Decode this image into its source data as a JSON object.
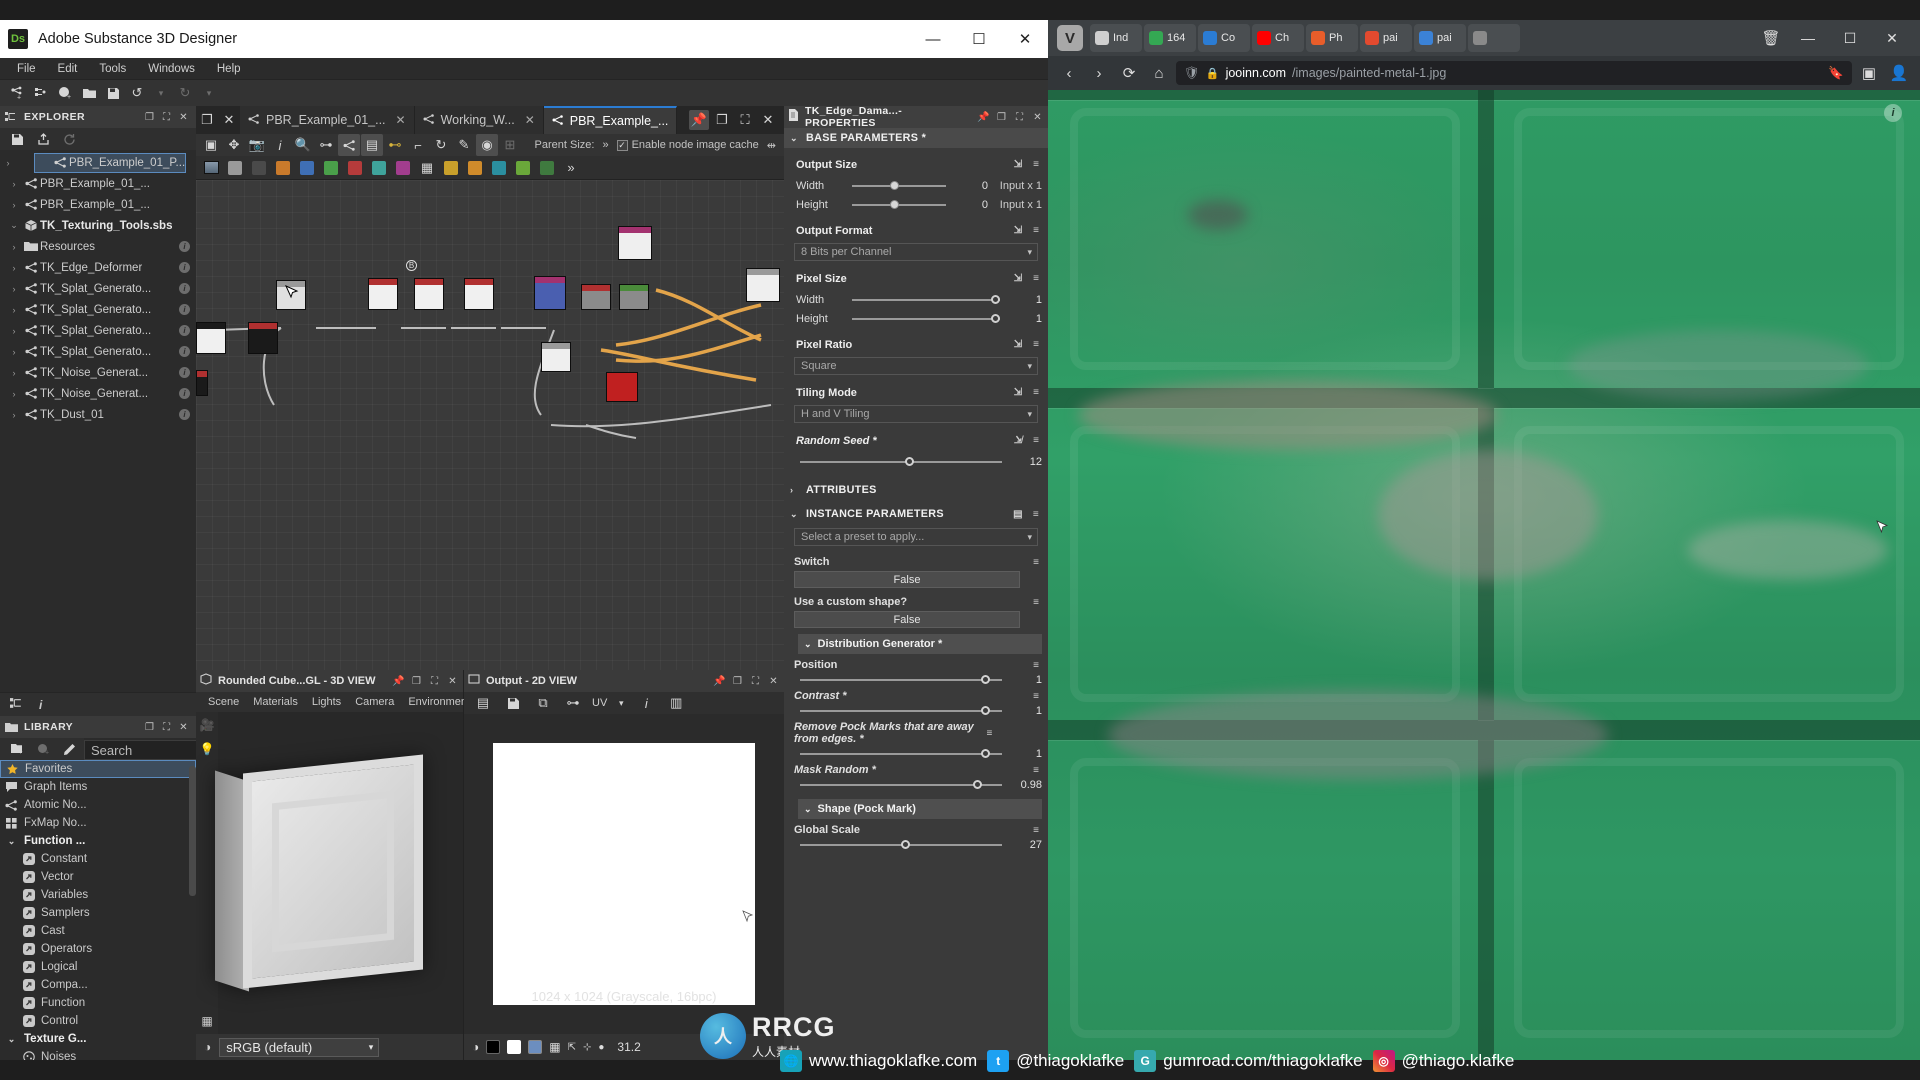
{
  "app": {
    "title": "Adobe Substance 3D Designer",
    "logo_text": "Ds",
    "window_buttons": {
      "minimize": "—",
      "maximize": "☐",
      "close": "✕"
    },
    "menus": [
      "File",
      "Edit",
      "Tools",
      "Windows",
      "Help"
    ],
    "toolbar_icons": [
      "new-graph-icon",
      "new-substance-icon",
      "new-package-icon",
      "open-icon",
      "save-icon",
      "undo-icon",
      "undo-dropdown-icon",
      "redo-icon",
      "redo-dropdown-icon"
    ]
  },
  "explorer": {
    "title": "EXPLORER",
    "panel_icon": "explorer-icon",
    "header_buttons": [
      "restore-icon",
      "float-icon",
      "close-icon"
    ],
    "toolbar": [
      "save-icon",
      "export-icon",
      "reload-icon"
    ],
    "items": [
      {
        "label": "PBR_Example_01_P...",
        "icon": "graph-icon",
        "selected": true,
        "indent": 1,
        "info": false,
        "bold": false
      },
      {
        "label": "PBR_Example_01_...",
        "icon": "graph-icon",
        "selected": false,
        "indent": 1,
        "info": false,
        "bold": false
      },
      {
        "label": "PBR_Example_01_...",
        "icon": "graph-icon",
        "selected": false,
        "indent": 1,
        "info": false,
        "bold": false
      },
      {
        "label": "TK_Texturing_Tools.sbs",
        "icon": "package-icon",
        "selected": false,
        "indent": 0,
        "info": false,
        "bold": true,
        "expanded": true
      },
      {
        "label": "Resources",
        "icon": "folder-icon",
        "selected": false,
        "indent": 1,
        "info": true,
        "bold": false
      },
      {
        "label": "TK_Edge_Deformer",
        "icon": "graph-icon",
        "selected": false,
        "indent": 1,
        "info": true,
        "bold": false
      },
      {
        "label": "TK_Splat_Generato...",
        "icon": "graph-icon",
        "selected": false,
        "indent": 1,
        "info": true,
        "bold": false
      },
      {
        "label": "TK_Splat_Generato...",
        "icon": "graph-icon",
        "selected": false,
        "indent": 1,
        "info": true,
        "bold": false
      },
      {
        "label": "TK_Splat_Generato...",
        "icon": "graph-icon",
        "selected": false,
        "indent": 1,
        "info": true,
        "bold": false
      },
      {
        "label": "TK_Splat_Generato...",
        "icon": "graph-icon",
        "selected": false,
        "indent": 1,
        "info": true,
        "bold": false
      },
      {
        "label": "TK_Noise_Generat...",
        "icon": "graph-icon",
        "selected": false,
        "indent": 1,
        "info": true,
        "bold": false
      },
      {
        "label": "TK_Noise_Generat...",
        "icon": "graph-icon",
        "selected": false,
        "indent": 1,
        "info": true,
        "bold": false
      },
      {
        "label": "TK_Dust_01",
        "icon": "graph-icon",
        "selected": false,
        "indent": 1,
        "info": true,
        "bold": false
      }
    ],
    "bottom_tabs": [
      "explorer-tab-icon",
      "info-tab-icon"
    ]
  },
  "library": {
    "title": "LIBRARY",
    "panel_icon": "folder-icon",
    "header_buttons": [
      "restore-icon",
      "float-icon",
      "close-icon"
    ],
    "toolbar": [
      "new-folder-icon",
      "new-item-icon",
      "edit-icon"
    ],
    "search_placeholder": "Search",
    "chevron": "»",
    "items": [
      {
        "label": "Favorites",
        "icon": "star-icon",
        "selected": true,
        "sub": false,
        "bold": false
      },
      {
        "label": "Graph Items",
        "icon": "comment-icon",
        "selected": false,
        "sub": false,
        "bold": false
      },
      {
        "label": "Atomic No...",
        "icon": "graph-icon",
        "selected": false,
        "sub": false,
        "bold": false
      },
      {
        "label": "FxMap No...",
        "icon": "fxmap-icon",
        "selected": false,
        "sub": false,
        "bold": false
      },
      {
        "label": "Function ...",
        "icon": "chevron-down-icon",
        "selected": false,
        "sub": false,
        "bold": true
      },
      {
        "label": "Constant",
        "icon": "function-icon",
        "selected": false,
        "sub": true,
        "bold": false
      },
      {
        "label": "Vector",
        "icon": "function-icon",
        "selected": false,
        "sub": true,
        "bold": false
      },
      {
        "label": "Variables",
        "icon": "function-icon",
        "selected": false,
        "sub": true,
        "bold": false
      },
      {
        "label": "Samplers",
        "icon": "function-icon",
        "selected": false,
        "sub": true,
        "bold": false
      },
      {
        "label": "Cast",
        "icon": "function-icon",
        "selected": false,
        "sub": true,
        "bold": false
      },
      {
        "label": "Operators",
        "icon": "function-icon",
        "selected": false,
        "sub": true,
        "bold": false
      },
      {
        "label": "Logical",
        "icon": "function-icon",
        "selected": false,
        "sub": true,
        "bold": false
      },
      {
        "label": "Compa...",
        "icon": "function-icon",
        "selected": false,
        "sub": true,
        "bold": false
      },
      {
        "label": "Function",
        "icon": "function-icon",
        "selected": false,
        "sub": true,
        "bold": false
      },
      {
        "label": "Control",
        "icon": "function-icon",
        "selected": false,
        "sub": true,
        "bold": false
      },
      {
        "label": "Texture G...",
        "icon": "chevron-down-icon",
        "selected": false,
        "sub": false,
        "bold": true
      },
      {
        "label": "Noises",
        "icon": "noise-icon",
        "selected": false,
        "sub": true,
        "bold": false
      }
    ]
  },
  "graph": {
    "tabs": [
      {
        "label": "PBR_Example_01_...",
        "active": false,
        "closable": true
      },
      {
        "label": "Working_W...",
        "active": false,
        "closable": true
      },
      {
        "label": "PBR_Example_...",
        "active": true,
        "closable": true
      }
    ],
    "tab_buttons": [
      "pin-icon",
      "restore-icon",
      "float-icon",
      "close-icon"
    ],
    "toolbar_icons": [
      "select-icon",
      "move-icon",
      "camera-icon",
      "info-icon",
      "zoom-icon",
      "input-icon",
      "graph-icon",
      "layers-icon",
      "link-icon",
      "curve-icon",
      "refresh-icon",
      "pen-icon",
      "bitmap-icon",
      "frame-icon"
    ],
    "parent_size_label": "Parent Size:",
    "parent_size_chevron": "»",
    "node_cache_label": "Enable node image cache",
    "node_cache_checked": true
  },
  "view3d": {
    "title": "Rounded Cube...GL - 3D VIEW",
    "panel_icon": "view3d-icon",
    "header_buttons": [
      "pin-icon",
      "restore-icon",
      "float-icon",
      "close-icon"
    ],
    "menus": [
      "Scene",
      "Materials",
      "Lights",
      "Camera",
      "Environment"
    ],
    "colorspace": "sRGB (default)",
    "colorspace_icon": "colorspace-icon",
    "rail_icons": [
      "camera-icon",
      "light-icon"
    ],
    "bottom_icon": "render-icon"
  },
  "view2d": {
    "title": "Output - 2D VIEW",
    "panel_icon": "view2d-icon",
    "header_buttons": [
      "pin-icon",
      "restore-icon",
      "float-icon",
      "close-icon"
    ],
    "toolbar_icons": [
      "layers-icon",
      "save-icon",
      "copy-icon",
      "link-icon",
      "uv-icon",
      "chevron-down-icon",
      "info-icon",
      "histogram-icon"
    ],
    "uv_label": "UV",
    "caption": "1024 x 1024 (Grayscale, 16bpc)",
    "status_icons": [
      "channels-icon",
      "black-swatch",
      "white-swatch",
      "rgb-swatch",
      "grid-icon",
      "tiling-icon",
      "center-icon",
      "dot-icon"
    ],
    "zoom_level": "31.2"
  },
  "properties": {
    "title": "TK_Edge_Dama...- PROPERTIES",
    "panel_icon": "document-icon",
    "header_buttons": [
      "pin-icon",
      "restore-icon",
      "float-icon",
      "close-icon"
    ],
    "sections": {
      "base": {
        "label": "BASE PARAMETERS *",
        "output_size_label": "Output Size",
        "width_label": "Width",
        "width_value": "0",
        "width_relative": "Input x 1",
        "height_label": "Height",
        "height_value": "0",
        "height_relative": "Input x 1",
        "output_format_label": "Output Format",
        "output_format_value": "8 Bits per Channel",
        "pixel_size_label": "Pixel Size",
        "pixel_width_label": "Width",
        "pixel_width_value": "1",
        "pixel_height_label": "Height",
        "pixel_height_value": "1",
        "pixel_ratio_label": "Pixel Ratio",
        "pixel_ratio_value": "Square",
        "tiling_mode_label": "Tiling Mode",
        "tiling_mode_value": "H and V Tiling",
        "random_seed_label": "Random Seed *",
        "random_seed_value": "12"
      },
      "attributes": {
        "label": "ATTRIBUTES"
      },
      "instance": {
        "label": "INSTANCE PARAMETERS",
        "preset_placeholder": "Select a preset to apply...",
        "switch_label": "Switch",
        "switch_value": "False",
        "custom_shape_label": "Use a custom shape?",
        "custom_shape_value": "False",
        "distribution_label": "Distribution Generator *",
        "position_label": "Position",
        "position_value": "1",
        "contrast_label": "Contrast *",
        "contrast_value": "1",
        "pockmarks_label": "Remove Pock Marks that are away from edges. *",
        "pockmarks_value": "1",
        "mask_random_label": "Mask Random *",
        "mask_random_value": "0.98",
        "shape_label": "Shape (Pock Mark)",
        "global_scale_label": "Global Scale",
        "global_scale_value": "27"
      }
    }
  },
  "browser": {
    "logo": "V",
    "window_buttons": {
      "minimize": "—",
      "maximize": "☐",
      "close": "✕"
    },
    "tabs": [
      {
        "label": "Ind",
        "favicon": "document-icon",
        "color": "#cfcfcf"
      },
      {
        "label": "164",
        "favicon": "maps-icon",
        "color": "#34a853"
      },
      {
        "label": "Co",
        "favicon": "cube-icon",
        "color": "#2b7cd3"
      },
      {
        "label": "Ch",
        "favicon": "youtube-icon",
        "color": "#ff0000"
      },
      {
        "label": "Ph",
        "favicon": "clock-icon",
        "color": "#e85d2a"
      },
      {
        "label": "pai",
        "favicon": "image-icon",
        "color": "#e34a2f"
      },
      {
        "label": "pai",
        "favicon": "grid-icon",
        "color": "#3b82d6"
      },
      {
        "label": "",
        "favicon": "plus-icon",
        "color": "#8a8a8a"
      }
    ],
    "nav_icons": [
      "back-icon",
      "forward-icon",
      "reload-icon",
      "home-icon"
    ],
    "url_shield_icon": "shield-icon",
    "url_lock_icon": "lock-icon",
    "url_domain": "jooinn.com",
    "url_path": "/images/painted-metal-1.jpg",
    "url_bookmark_icon": "bookmark-icon",
    "url_profile_icon": "profile-icon",
    "trash_icon": "trash-icon",
    "panel_icon": "panel-icon",
    "image_info_icon": "info-icon"
  },
  "watermark": {
    "brand": "RRCG",
    "brand_sub": "人人素材",
    "site": "www.thiagoklafke.com",
    "twitter": "@thiagoklafke",
    "gumroad": "gumroad.com/thiagoklafke",
    "instagram": "@thiago.klafke"
  }
}
